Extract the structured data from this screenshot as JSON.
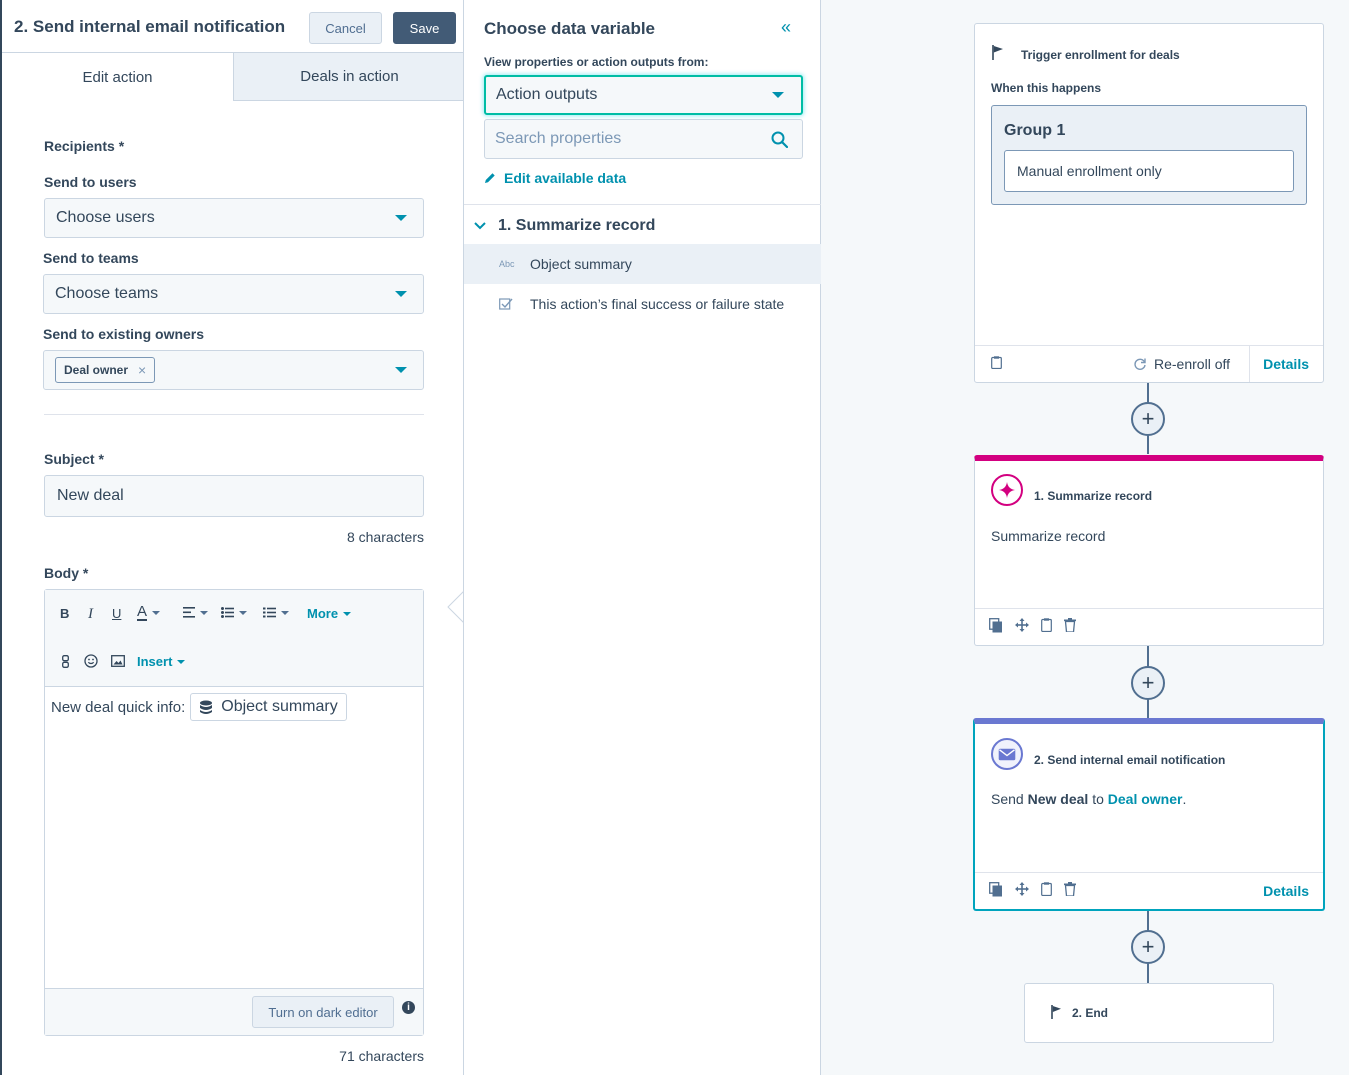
{
  "edit_panel": {
    "title": "2. Send internal email notification",
    "cancel_label": "Cancel",
    "save_label": "Save",
    "tabs": [
      {
        "label": "Edit action",
        "active": true
      },
      {
        "label": "Deals in action",
        "active": false
      }
    ],
    "recipients_label": "Recipients *",
    "send_to_users": {
      "label": "Send to users",
      "value": "Choose users"
    },
    "send_to_teams": {
      "label": "Send to teams",
      "value": "Choose teams"
    },
    "send_to_owners": {
      "label": "Send to existing owners",
      "chip": "Deal owner",
      "chip_remove": "×"
    },
    "subject": {
      "label": "Subject *",
      "value": "New deal",
      "count": "8 characters"
    },
    "body": {
      "label": "Body *",
      "toolbar": {
        "bold": "B",
        "italic": "I",
        "underline": "U",
        "text_color": "A",
        "more": "More",
        "insert": "Insert"
      },
      "text": "New deal quick info:",
      "token": "Object summary",
      "dark_editor_label": "Turn on dark editor",
      "info": "i",
      "count": "71 characters"
    }
  },
  "variable_panel": {
    "title": "Choose data variable",
    "collapse": "«",
    "source_label": "View properties or action outputs from:",
    "source_value": "Action outputs",
    "search_placeholder": "Search properties",
    "edit_data_label": "Edit available data",
    "group": "1. Summarize record",
    "items": [
      {
        "icon": "Abc",
        "label": "Object summary",
        "selected": true
      },
      {
        "label": "This action’s final success or failure state",
        "selected": false
      }
    ]
  },
  "workflow": {
    "trigger": {
      "title": "Trigger enrollment for deals",
      "when": "When this happens",
      "group_label": "Group 1",
      "group_value": "Manual enrollment only",
      "reenroll": "Re-enroll off",
      "details": "Details"
    },
    "step1": {
      "title": "1. Summarize record",
      "description": "Summarize record",
      "accent": "#d30080"
    },
    "step2": {
      "title": "2. Send internal email notification",
      "desc_send": "Send",
      "desc_subject": "New deal",
      "desc_to": "to",
      "desc_recipient": "Deal owner",
      "desc_end": ".",
      "details": "Details",
      "accent": "#6a78d1"
    },
    "end": {
      "title": "2. End"
    },
    "add_symbol": "+"
  },
  "colors": {
    "accent_teal": "#0091ae",
    "text": "#33475b",
    "ai_pink": "#d30080",
    "email_purple": "#6a78d1"
  }
}
